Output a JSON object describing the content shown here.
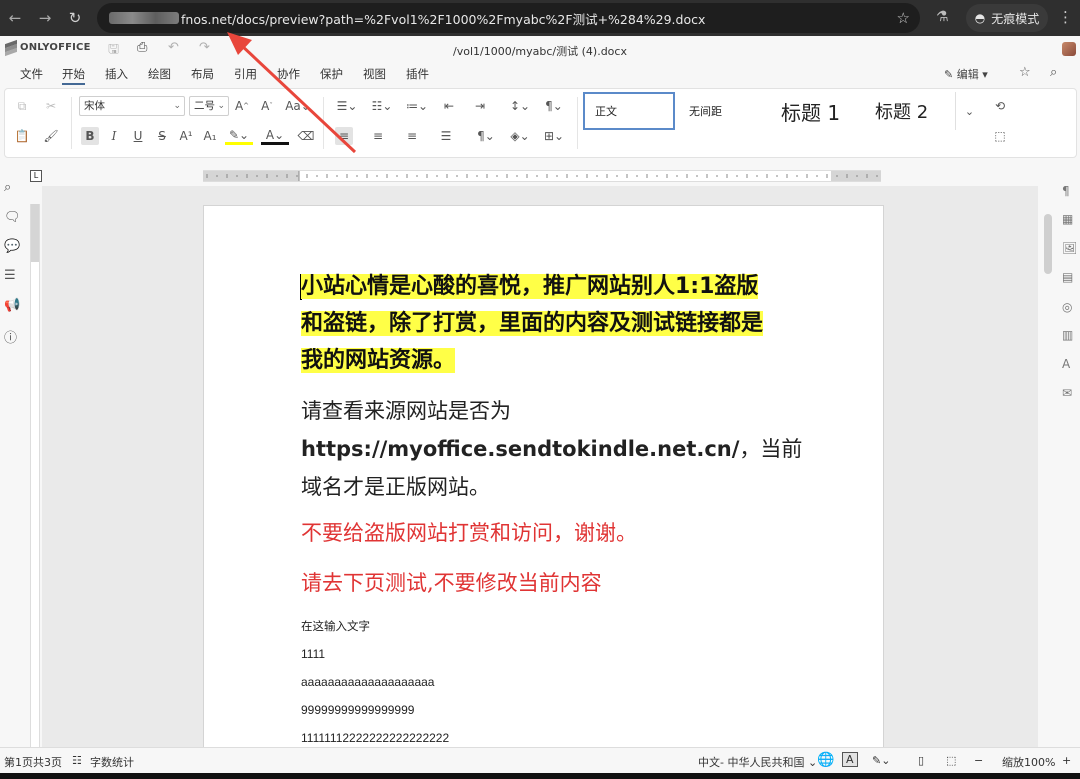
{
  "browser": {
    "url": "fnos.net/docs/preview?path=%2Fvol1%2F1000%2Fmyabc%2F测试+%284%29.docx",
    "incognito_label": "无痕模式",
    "back_icon": "arrow-left-icon",
    "forward_icon": "arrow-right-icon",
    "reload_icon": "reload-icon",
    "star_icon": "bookmark-star-icon"
  },
  "app": {
    "logo": "ONLYOFFICE",
    "doc_title": "/vol1/1000/myabc/测试 (4).docx"
  },
  "menu": [
    "文件",
    "开始",
    "插入",
    "绘图",
    "布局",
    "引用",
    "协作",
    "保护",
    "视图",
    "插件"
  ],
  "menu_active": "开始",
  "edit_mode": "编辑",
  "toolbar": {
    "font_name": "宋体",
    "font_size": "二号",
    "styles": [
      "正文",
      "无间距",
      "标题 1",
      "标题 2"
    ]
  },
  "document": {
    "p1": "小站心情是心酸的喜悦，推广网站别人1:1盗版和盗链，除了打赏，里面的内容及测试链接都是我的网站资源。",
    "p1_lines": [
      "小站心情是心酸的喜悦，推广网站别人1:1盗版",
      "和盗链，除了打赏，里面的内容及测试链接都是",
      "我的网站资源。"
    ],
    "p2_line1": "请查看来源网站是否为",
    "p2_link": "https://myoffice.sendtokindle.net.cn/",
    "p2_suffix": "，当前",
    "p2_line3": "域名才是正版网站。",
    "p3": "不要给盗版网站打赏和访问，谢谢。",
    "p4": "请去下页测试,不要修改当前内容",
    "p5": "在这输入文字",
    "p6": "1111",
    "p7": "aaaaaaaaaaaaaaaaaaaa",
    "p8": "99999999999999999",
    "p9": "11111112222222222222222"
  },
  "status": {
    "page_info": "第1页共3页",
    "word_count": "字数统计",
    "language": "中文- 中华人民共和国",
    "zoom": "缩放100%"
  }
}
